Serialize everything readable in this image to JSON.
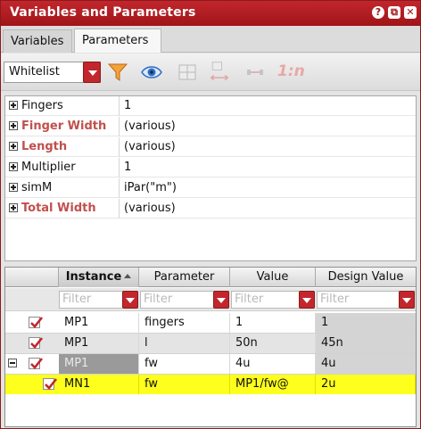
{
  "window": {
    "title": "Variables and Parameters",
    "buttons": {
      "help": "?",
      "float": "⧉",
      "close": "✕"
    }
  },
  "tabs": [
    {
      "label": "Variables",
      "active": false
    },
    {
      "label": "Parameters",
      "active": true
    }
  ],
  "toolbar": {
    "filter_mode": "Whitelist",
    "icons": [
      "filter-icon",
      "eye-icon",
      "grid-icon",
      "swap-icon",
      "separator-icon"
    ],
    "ratio_label": "1:n"
  },
  "properties": [
    {
      "name": "Fingers",
      "value": "1",
      "highlight": false
    },
    {
      "name": "Finger Width",
      "value": "(various)",
      "highlight": true
    },
    {
      "name": "Length",
      "value": "(various)",
      "highlight": true
    },
    {
      "name": "Multiplier",
      "value": "1",
      "highlight": false
    },
    {
      "name": "simM",
      "value": "iPar(\"m\")",
      "highlight": false
    },
    {
      "name": "Total Width",
      "value": "(various)",
      "highlight": true
    }
  ],
  "table": {
    "columns": [
      "Instance",
      "Parameter",
      "Value",
      "Design Value"
    ],
    "sorted_column": "Instance",
    "filter_placeholder": "Filter",
    "rows": [
      {
        "instance": "MP1",
        "parameter": "fingers",
        "value": "1",
        "design_value": "1",
        "checked": true
      },
      {
        "instance": "MP1",
        "parameter": "l",
        "value": "50n",
        "design_value": "45n",
        "checked": true
      },
      {
        "instance": "MP1",
        "parameter": "fw",
        "value": "4u",
        "design_value": "4u",
        "checked": true,
        "expanded": true
      },
      {
        "instance": "MN1",
        "parameter": "fw",
        "value": "MP1/fw@",
        "design_value": "2u",
        "checked": true,
        "child": true
      }
    ]
  },
  "colors": {
    "accent": "#c1272d",
    "highlight_text": "#c0504d",
    "row_highlight": "#ffff1e"
  }
}
